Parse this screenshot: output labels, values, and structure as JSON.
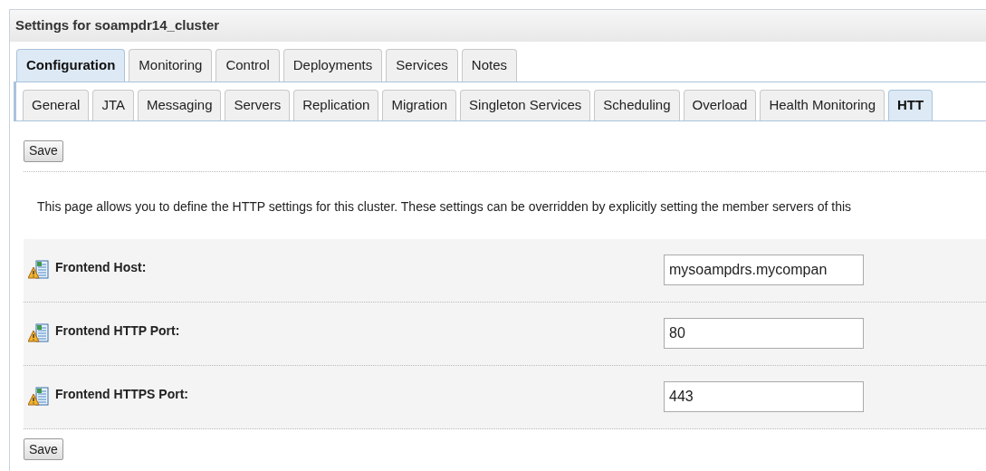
{
  "header": {
    "title": "Settings for soampdr14_cluster"
  },
  "tabs": [
    {
      "label": "Configuration",
      "selected": true
    },
    {
      "label": "Monitoring",
      "selected": false
    },
    {
      "label": "Control",
      "selected": false
    },
    {
      "label": "Deployments",
      "selected": false
    },
    {
      "label": "Services",
      "selected": false
    },
    {
      "label": "Notes",
      "selected": false
    }
  ],
  "subtabs": [
    {
      "label": "General",
      "selected": false
    },
    {
      "label": "JTA",
      "selected": false
    },
    {
      "label": "Messaging",
      "selected": false
    },
    {
      "label": "Servers",
      "selected": false
    },
    {
      "label": "Replication",
      "selected": false
    },
    {
      "label": "Migration",
      "selected": false
    },
    {
      "label": "Singleton Services",
      "selected": false
    },
    {
      "label": "Scheduling",
      "selected": false
    },
    {
      "label": "Overload",
      "selected": false
    },
    {
      "label": "Health Monitoring",
      "selected": false
    },
    {
      "label": "HTT",
      "selected": true
    }
  ],
  "top_button": "Save",
  "description": "This page allows you to define the HTTP settings for this cluster. These settings can be overridden by explicitly setting the member servers of this",
  "fields": [
    {
      "label": "Frontend Host:",
      "value": "mysoampdrs.mycompan"
    },
    {
      "label": "Frontend HTTP Port:",
      "value": "80"
    },
    {
      "label": "Frontend HTTPS Port:",
      "value": "443"
    }
  ],
  "bottom_button": "Save"
}
